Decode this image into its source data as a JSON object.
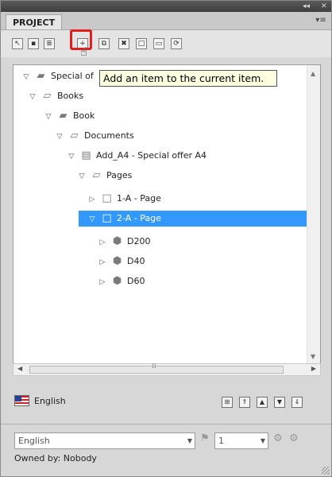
{
  "panel": {
    "tab_label": "PROJECT",
    "menu_icon": "panel-menu-icon",
    "title_controls": [
      "◂◂",
      "✕"
    ]
  },
  "toolbar": {
    "buttons": [
      {
        "name": "select-icon"
      },
      {
        "name": "save-icon"
      },
      {
        "name": "properties-icon"
      },
      {
        "name": "add-item-icon"
      },
      {
        "name": "duplicate-icon"
      },
      {
        "name": "delete-icon"
      },
      {
        "name": "blank-page-icon"
      },
      {
        "name": "layout-icon"
      },
      {
        "name": "refresh-icon"
      }
    ]
  },
  "tooltip": {
    "text": "Add an item to the current item."
  },
  "tree": {
    "nodes": [
      {
        "label": "Special of",
        "level": 0,
        "expanded": true,
        "icon": "project-icon"
      },
      {
        "label": "Books",
        "level": 1,
        "expanded": true,
        "icon": "folder-icon"
      },
      {
        "label": "Book",
        "level": 2,
        "expanded": true,
        "icon": "book-icon"
      },
      {
        "label": "Documents",
        "level": 3,
        "expanded": true,
        "icon": "folder-icon"
      },
      {
        "label": "Add_A4 - Special offer A4",
        "level": 4,
        "expanded": true,
        "icon": "document-icon"
      },
      {
        "label": "Pages",
        "level": 5,
        "expanded": true,
        "icon": "folder-icon"
      },
      {
        "label": "1-A - Page",
        "level": 6,
        "expanded": false,
        "icon": "page-icon"
      },
      {
        "label": "2-A - Page",
        "level": 6,
        "expanded": true,
        "icon": "page-icon",
        "selected": true
      },
      {
        "label": "D200",
        "level": 7,
        "expanded": false,
        "icon": "product-icon"
      },
      {
        "label": "D40",
        "level": 7,
        "expanded": false,
        "icon": "product-icon"
      },
      {
        "label": "D60",
        "level": 7,
        "expanded": false,
        "icon": "product-icon"
      }
    ]
  },
  "language": {
    "label": "English",
    "flag_icon": "us-flag-icon",
    "nav_buttons": [
      "tree-toggle-icon",
      "collapse-all-icon",
      "move-up-icon",
      "move-down-icon",
      "expand-all-icon"
    ]
  },
  "footer": {
    "language_select": "English",
    "page_select": "1",
    "owned_by": "Owned by: Nobody"
  },
  "colors": {
    "selection": "#3399ff",
    "highlight": "#e01e1e",
    "tooltip_bg": "#ffffe1"
  }
}
